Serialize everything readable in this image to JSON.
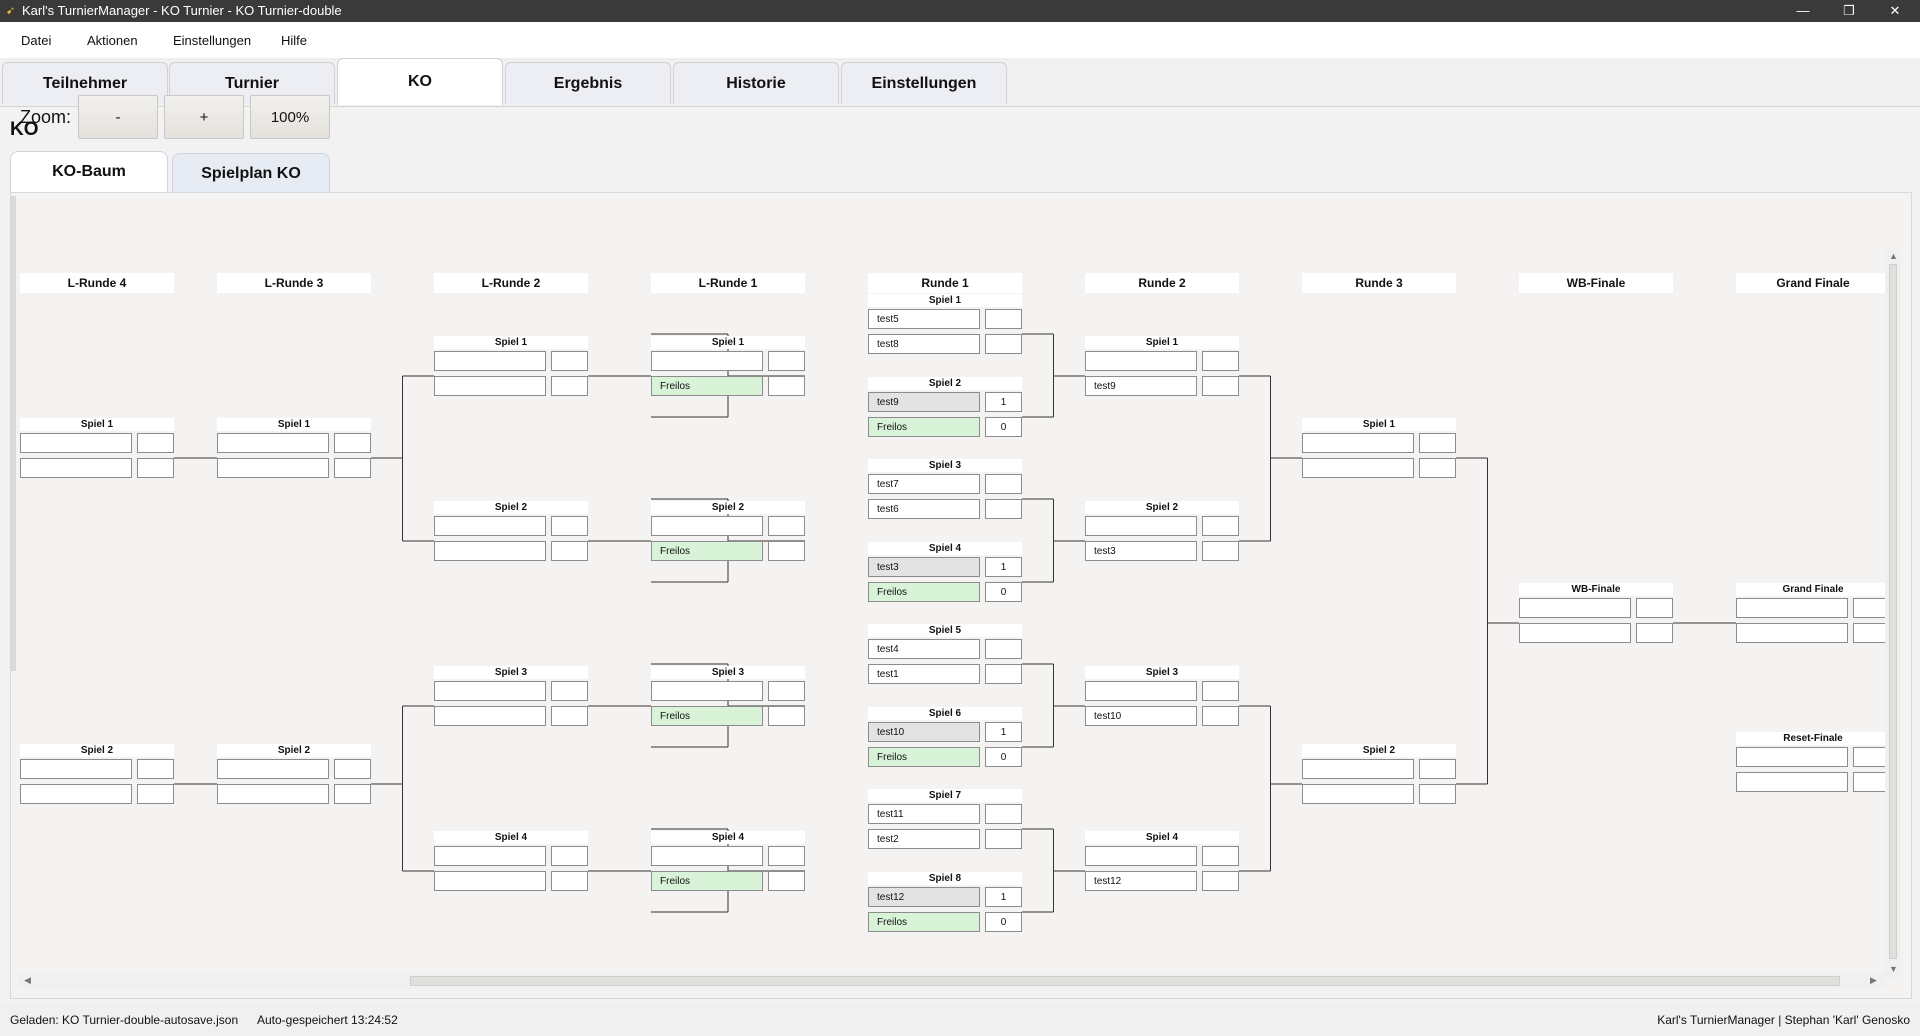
{
  "window": {
    "title": "Karl's TurnierManager - KO Turnier - KO Turnier-double",
    "min": "—",
    "max": "❐",
    "close": "✕"
  },
  "menu": [
    "Datei",
    "Aktionen",
    "Einstellungen",
    "Hilfe"
  ],
  "tabs": [
    "Teilnehmer",
    "Turnier",
    "KO",
    "Ergebnis",
    "Historie",
    "Einstellungen"
  ],
  "active_tab": "KO",
  "section_title": "KO",
  "subtabs": [
    "KO-Baum",
    "Spielplan KO"
  ],
  "zoom": {
    "label": "Zoom:",
    "minus": "-",
    "plus": "+",
    "level": "100%"
  },
  "columns": [
    "L-Runde 4",
    "L-Runde 3",
    "L-Runde 2",
    "L-Runde 1",
    "Runde 1",
    "Runde 2",
    "Runde 3",
    "WB-Finale",
    "Grand Finale"
  ],
  "matches": [
    {
      "round": 0,
      "label": "Spiel 1",
      "p1": "",
      "p2": "",
      "s1": "",
      "s2": ""
    },
    {
      "round": 0,
      "label": "Spiel 2",
      "p1": "",
      "p2": "",
      "s1": "",
      "s2": ""
    },
    {
      "round": 1,
      "label": "Spiel 1",
      "p1": "",
      "p2": "",
      "s1": "",
      "s2": ""
    },
    {
      "round": 1,
      "label": "Spiel 2",
      "p1": "",
      "p2": "",
      "s1": "",
      "s2": ""
    },
    {
      "round": 2,
      "label": "Spiel 1",
      "p1": "",
      "p2": "",
      "s1": "",
      "s2": ""
    },
    {
      "round": 2,
      "label": "Spiel 2",
      "p1": "",
      "p2": "",
      "s1": "",
      "s2": ""
    },
    {
      "round": 2,
      "label": "Spiel 3",
      "p1": "",
      "p2": "",
      "s1": "",
      "s2": ""
    },
    {
      "round": 2,
      "label": "Spiel 4",
      "p1": "",
      "p2": "",
      "s1": "",
      "s2": ""
    },
    {
      "round": 3,
      "label": "Spiel 1",
      "p1": "",
      "p2": "Freilos",
      "s1": "",
      "s2": "",
      "p2_state": "bye"
    },
    {
      "round": 3,
      "label": "Spiel 2",
      "p1": "",
      "p2": "Freilos",
      "s1": "",
      "s2": "",
      "p2_state": "bye"
    },
    {
      "round": 3,
      "label": "Spiel 3",
      "p1": "",
      "p2": "Freilos",
      "s1": "",
      "s2": "",
      "p2_state": "bye"
    },
    {
      "round": 3,
      "label": "Spiel 4",
      "p1": "",
      "p2": "Freilos",
      "s1": "",
      "s2": "",
      "p2_state": "bye"
    },
    {
      "round": 4,
      "label": "Spiel 1",
      "p1": "test5",
      "p2": "test8",
      "s1": "",
      "s2": ""
    },
    {
      "round": 4,
      "label": "Spiel 2",
      "p1": "test9",
      "p2": "Freilos",
      "s1": "1",
      "s2": "0",
      "p1_state": "winner",
      "p2_state": "bye"
    },
    {
      "round": 4,
      "label": "Spiel 3",
      "p1": "test7",
      "p2": "test6",
      "s1": "",
      "s2": ""
    },
    {
      "round": 4,
      "label": "Spiel 4",
      "p1": "test3",
      "p2": "Freilos",
      "s1": "1",
      "s2": "0",
      "p1_state": "winner",
      "p2_state": "bye"
    },
    {
      "round": 4,
      "label": "Spiel 5",
      "p1": "test4",
      "p2": "test1",
      "s1": "",
      "s2": ""
    },
    {
      "round": 4,
      "label": "Spiel 6",
      "p1": "test10",
      "p2": "Freilos",
      "s1": "1",
      "s2": "0",
      "p1_state": "winner",
      "p2_state": "bye"
    },
    {
      "round": 4,
      "label": "Spiel 7",
      "p1": "test11",
      "p2": "test2",
      "s1": "",
      "s2": ""
    },
    {
      "round": 4,
      "label": "Spiel 8",
      "p1": "test12",
      "p2": "Freilos",
      "s1": "1",
      "s2": "0",
      "p1_state": "winner",
      "p2_state": "bye"
    },
    {
      "round": 5,
      "label": "Spiel 1",
      "p1": "",
      "p2": "test9",
      "s1": "",
      "s2": ""
    },
    {
      "round": 5,
      "label": "Spiel 2",
      "p1": "",
      "p2": "test3",
      "s1": "",
      "s2": ""
    },
    {
      "round": 5,
      "label": "Spiel 3",
      "p1": "",
      "p2": "test10",
      "s1": "",
      "s2": ""
    },
    {
      "round": 5,
      "label": "Spiel 4",
      "p1": "",
      "p2": "test12",
      "s1": "",
      "s2": ""
    },
    {
      "round": 6,
      "label": "Spiel 1",
      "p1": "",
      "p2": "",
      "s1": "",
      "s2": ""
    },
    {
      "round": 6,
      "label": "Spiel 2",
      "p1": "",
      "p2": "",
      "s1": "",
      "s2": ""
    },
    {
      "round": 7,
      "label": "WB-Finale",
      "p1": "",
      "p2": "",
      "s1": "",
      "s2": ""
    },
    {
      "round": 8,
      "label": "Grand Finale",
      "p1": "",
      "p2": "",
      "s1": "",
      "s2": ""
    },
    {
      "round": 8,
      "label": "Reset-Finale",
      "p1": "",
      "p2": "",
      "s1": "",
      "s2": ""
    }
  ],
  "status": {
    "loaded": "Geladen: KO Turnier-double-autosave.json",
    "autosave": "Auto-gespeichert 13:24:52",
    "app": "Karl's TurnierManager | Stephan 'Karl' Genosko"
  }
}
